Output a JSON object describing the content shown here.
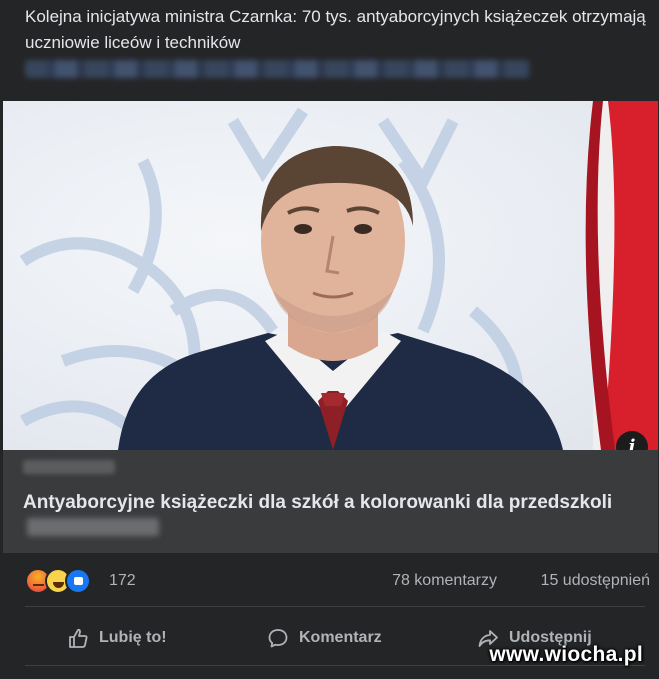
{
  "post": {
    "text": "Kolejna inicjatywa ministra Czarnka: 70 tys. antyaborcyjnych książeczek otrzymają uczniowie liceów i techników"
  },
  "link_card": {
    "title": "Antyaborcyjne książeczki dla szkół a kolorowanki dla przedszkoli",
    "info_icon": "i"
  },
  "stats": {
    "reactions": [
      "angry",
      "haha",
      "like"
    ],
    "reaction_count": "172",
    "comments": "78 komentarzy",
    "shares": "15 udostępnień"
  },
  "actions": {
    "like": "Lubię to!",
    "comment": "Komentarz",
    "share": "Udostępnij"
  },
  "watermark": {
    "text": "www.wiocha.pl"
  },
  "colors": {
    "background": "#242526",
    "card_meta": "#3a3b3c",
    "text_primary": "#e4e6eb",
    "text_secondary": "#b0b3b8"
  }
}
